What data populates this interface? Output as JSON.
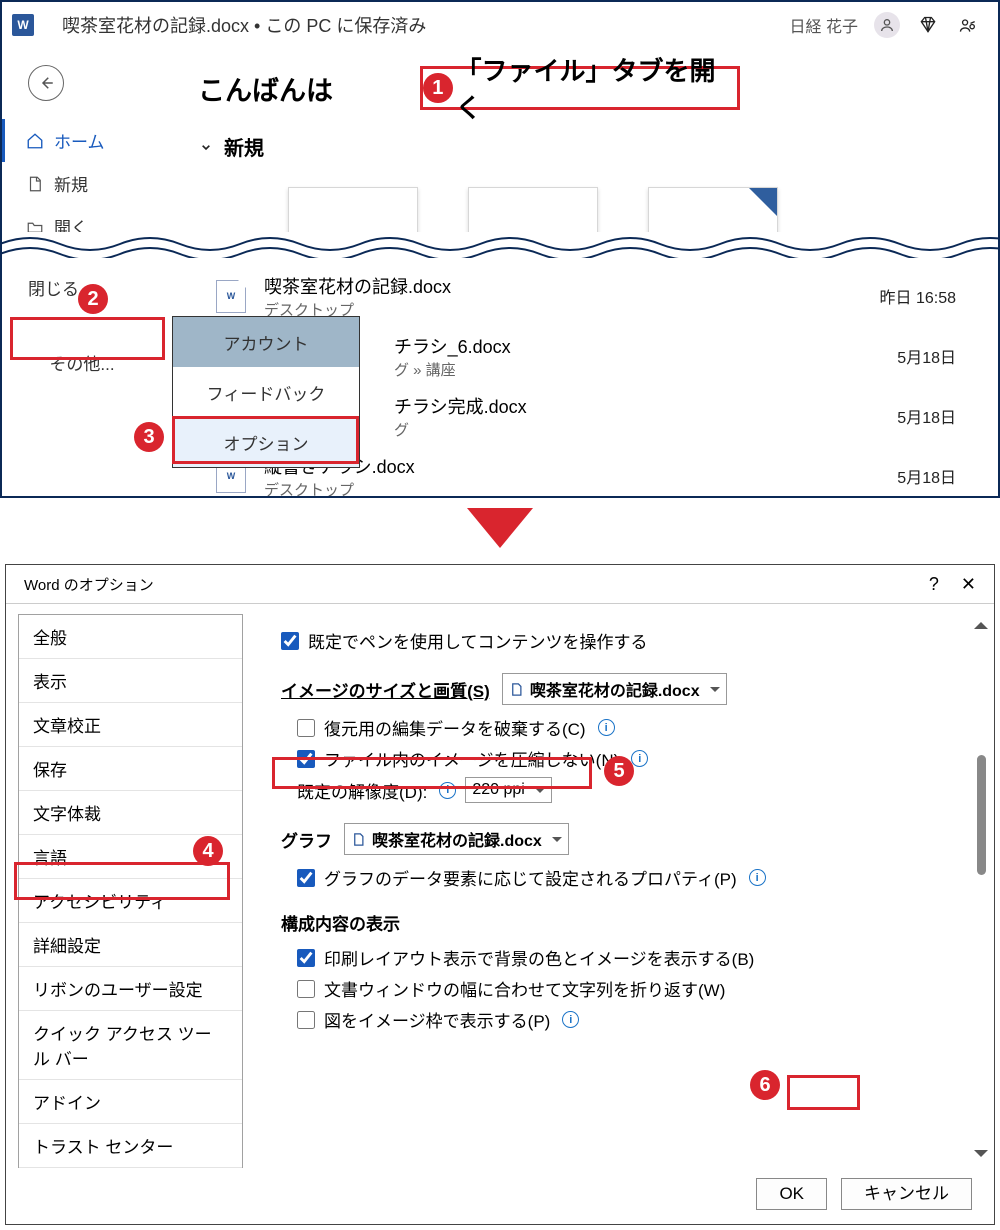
{
  "titlebar": {
    "filename": "喫茶室花材の記録.docx",
    "save_state": "• この PC に保存済み",
    "username": "日経 花子"
  },
  "callout1": "「ファイル」タブを開く",
  "greeting": "こんばんは",
  "new_header": "新規",
  "nav": {
    "home": "ホーム",
    "new": "新規",
    "open": "開く",
    "close": "閉じる",
    "more": "その他..."
  },
  "more_menu": {
    "account": "アカウント",
    "feedback": "フィードバック",
    "options": "オプション"
  },
  "recent": [
    {
      "name": "喫茶室花材の記録.docx",
      "path": "デスクトップ",
      "time": "昨日 16:58"
    },
    {
      "name": "チラシ_6.docx",
      "path": "グ » 講座",
      "time": "5月18日"
    },
    {
      "name": "チラシ完成.docx",
      "path": "グ",
      "time": "5月18日"
    },
    {
      "name": "縦書きチラシ.docx",
      "path": "デスクトップ",
      "time": "5月18日"
    }
  ],
  "dialog": {
    "title": "Word のオプション",
    "ok": "OK",
    "cancel": "キャンセル",
    "categories": [
      "全般",
      "表示",
      "文章校正",
      "保存",
      "文字体裁",
      "言語",
      "アクセシビリティ",
      "詳細設定",
      "リボンのユーザー設定",
      "クイック アクセス ツール バー",
      "アドイン",
      "トラスト センター"
    ],
    "opt_pen": "既定でペンを使用してコンテンツを操作する",
    "sec_image": "イメージのサイズと画質(S)",
    "image_target": "喫茶室花材の記録.docx",
    "opt_discard": "復元用の編集データを破棄する(C)",
    "opt_no_compress": "ファイル内のイメージを圧縮しない(N)",
    "lbl_default_res": "既定の解像度(D):",
    "default_res": "220 ppi",
    "sec_chart": "グラフ",
    "chart_target": "喫茶室花材の記録.docx",
    "opt_chart_prop": "グラフのデータ要素に応じて設定されるプロパティ(P)",
    "sec_layout": "構成内容の表示",
    "opt_bg": "印刷レイアウト表示で背景の色とイメージを表示する(B)",
    "opt_wrap": "文書ウィンドウの幅に合わせて文字列を折り返す(W)",
    "opt_frame": "図をイメージ枠で表示する(P)"
  }
}
